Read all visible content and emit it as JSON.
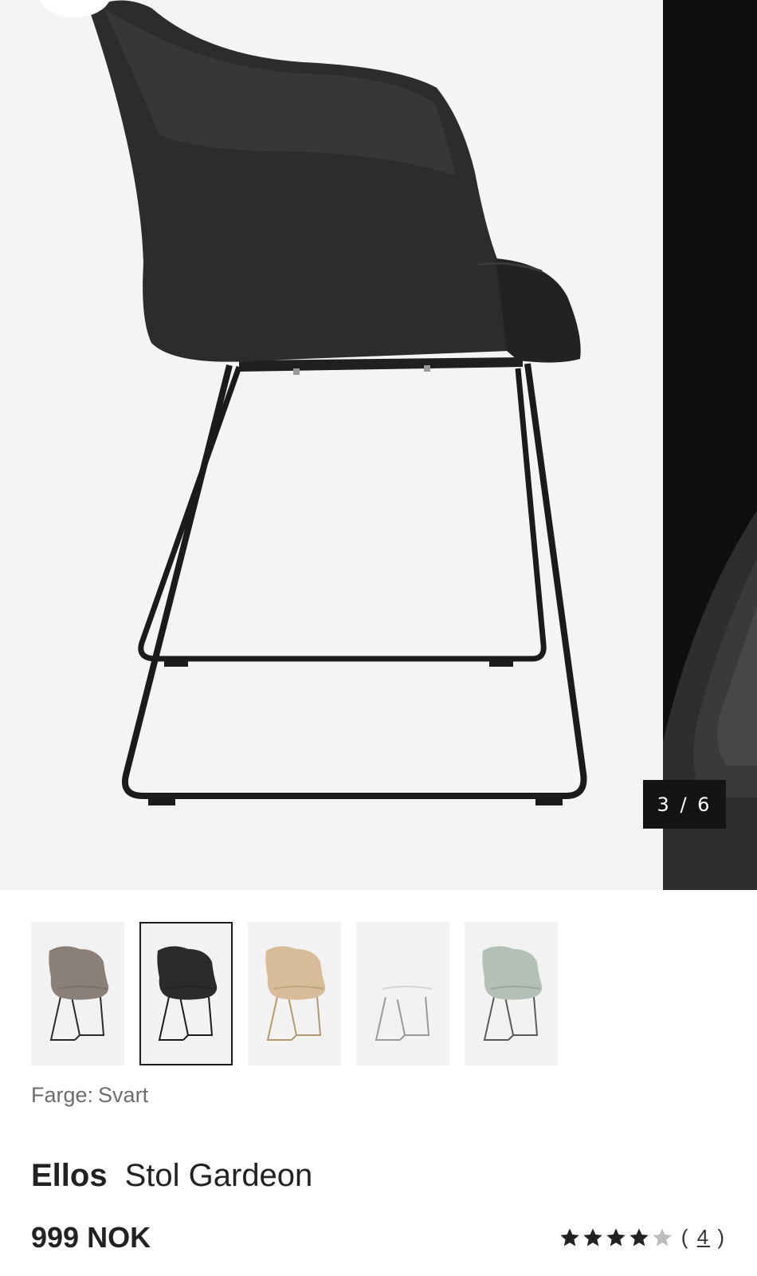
{
  "gallery": {
    "counter": "3 / 6",
    "current_index": 3,
    "total": 6
  },
  "variants": [
    {
      "name": "brown-grey",
      "shell": "#8b8078",
      "legs": "#2a2a2a"
    },
    {
      "name": "black",
      "shell": "#2b2b2b",
      "legs": "#1c1c1c",
      "selected": true
    },
    {
      "name": "beige",
      "shell": "#d8bc98",
      "legs": "#b39b6c"
    },
    {
      "name": "white",
      "shell": "#f2f2f2",
      "legs": "#9a9a9a"
    },
    {
      "name": "sage",
      "shell": "#b3c0b6",
      "legs": "#5a5a5a"
    }
  ],
  "color": {
    "label": "Farge:",
    "value": "Svart"
  },
  "product": {
    "brand": "Ellos",
    "name": "Stol Gardeon",
    "price": "999 NOK"
  },
  "rating": {
    "stars": 4,
    "max": 5,
    "open": "(",
    "count": "4",
    "close": ")",
    "filled_color": "#222222",
    "empty_color": "#bdbdbd"
  }
}
